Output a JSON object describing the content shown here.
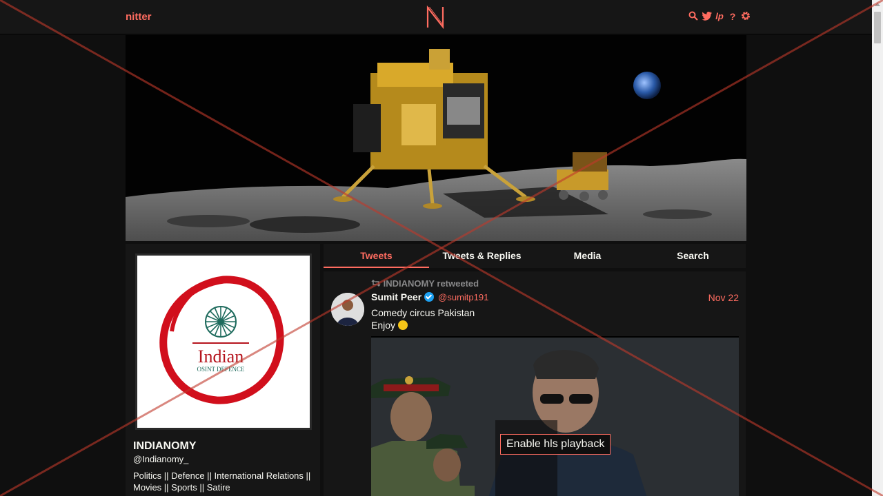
{
  "navbar": {
    "brand": "nitter",
    "icons": [
      "search-icon",
      "twitter-bird-icon",
      "liberapay-icon",
      "help-icon",
      "gear-icon"
    ]
  },
  "colors": {
    "accent": "#ff6c60",
    "background": "#0f0f0f",
    "panel": "#161616",
    "text": "#f8f8f2",
    "muted": "#888889",
    "verified": "#1da1f2"
  },
  "profile": {
    "fullname": "INDIANOMY",
    "username": "@Indianomy_",
    "bio": "Politics || Defence || International Relations || Movies || Sports || Satire",
    "avatar_text": "Indian",
    "avatar_subtext": "OSINT DEFENCE"
  },
  "tabs": [
    {
      "label": "Tweets",
      "active": true
    },
    {
      "label": "Tweets & Replies",
      "active": false
    },
    {
      "label": "Media",
      "active": false
    },
    {
      "label": "Search",
      "active": false
    }
  ],
  "tweet": {
    "retweet_header": "INDIANOMY retweeted",
    "name": "Sumit Peer",
    "handle": "@sumitp191",
    "date": "Nov 22",
    "line1": "Comedy circus Pakistan",
    "line2": "Enjoy",
    "hls_button": "Enable hls playback"
  }
}
